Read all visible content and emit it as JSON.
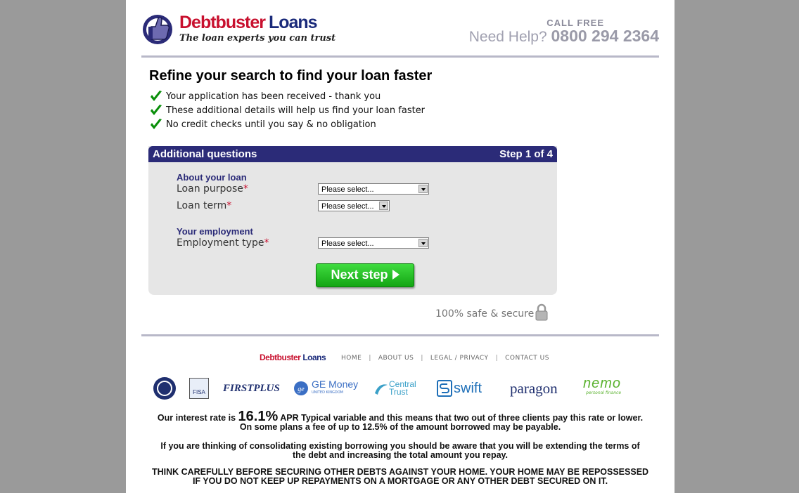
{
  "header": {
    "brand_part1": "Debtbuster",
    "brand_part2": "Loans",
    "tagline": "The loan experts you can trust",
    "call_free": "CALL FREE",
    "need_help": "Need Help?",
    "phone": "0800 294 2364"
  },
  "intro": {
    "title": "Refine your search to find your loan faster",
    "bullets": [
      "Your application has been received - thank you",
      "These additional details will help us find your loan faster",
      "No credit checks until you say & no obligation"
    ]
  },
  "form": {
    "heading": "Additional questions",
    "step": "Step 1 of 4",
    "section_loan": "About your loan",
    "loan_purpose_label": "Loan purpose",
    "loan_term_label": "Loan term",
    "section_employment": "Your employment",
    "employment_type_label": "Employment type",
    "required_mark": "*",
    "loan_purpose_value": "Please select...",
    "loan_term_value": "Please select...",
    "employment_type_value": "Please select...",
    "next_button": "Next step"
  },
  "secure_text": "100% safe & secure",
  "footer": {
    "brand_part1": "Debtbuster",
    "brand_part2": "Loans",
    "nav": [
      "HOME",
      "ABOUT US",
      "LEGAL / PRIVACY",
      "CONTACT US"
    ],
    "partners": [
      "FIRSTPLUS",
      "GE Money",
      "Central Trust",
      "swift",
      "paragon",
      "nemo"
    ],
    "partner_small": {
      "fisa": "FISA",
      "ge_sub": "UNITED KINGDOM",
      "nemo_sub": "personal finance"
    },
    "disclaimer_rate_pre": "Our interest rate is",
    "disclaimer_rate": "16.1%",
    "disclaimer_rate_post": "APR Typical variable and this means that two out of three clients pay this rate or lower.",
    "disclaimer_fee": "On some plans a fee of up to 12.5% of the amount borrowed may be payable.",
    "disclaimer_consolidate_1": "If you are thinking of consolidating existing borrowing you should be aware that you will be extending the terms of",
    "disclaimer_consolidate_2": "the debt and increasing the total amount you repay.",
    "disclaimer_warning_1": "THINK CAREFULLY BEFORE SECURING OTHER DEBTS AGAINST YOUR HOME. YOUR HOME MAY BE REPOSSESSED",
    "disclaimer_warning_2": "IF YOU DO NOT KEEP UP REPAYMENTS ON A MORTGAGE OR ANY OTHER DEBT SECURED ON IT."
  },
  "colors": {
    "brand_red": "#c8102e",
    "brand_navy": "#2b2b78",
    "button_green": "#1fbf1f",
    "page_bg": "#9a9a9a"
  }
}
